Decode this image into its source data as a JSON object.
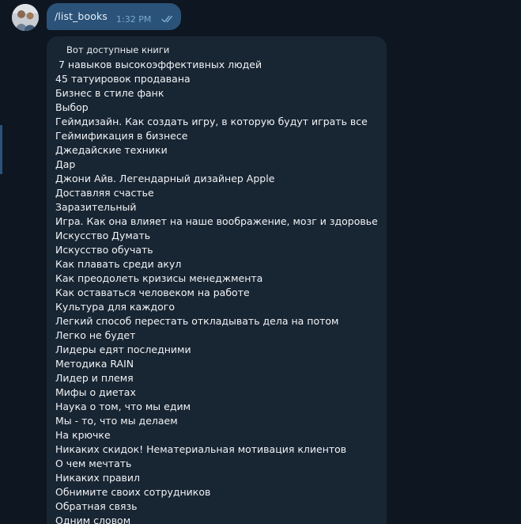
{
  "outgoing": {
    "text": "/list_books",
    "time": "1:32 PM"
  },
  "incoming": {
    "header": "Вот доступные книги",
    "books": [
      " 7 навыков высокоэффективных людей",
      "45 татуировок продавана",
      "Бизнес в стиле фанк",
      "Выбор",
      "Геймдизайн. Как создать игру, в которую будут играть все",
      "Геймификация в бизнесе",
      "Джедайские техники",
      "Дар",
      "Джони Айв. Легендарный дизайнер Apple",
      "Доставляя счастье",
      "Заразительный",
      "Игра. Как она влияет на наше воображение, мозг и здоровье",
      "Искусство Думать",
      "Искусство обучать",
      "Как плавать среди акул",
      "Как преодолеть кризисы менеджмента",
      "Как оставаться человеком на работе",
      "Культура для каждого",
      "Легкий способ перестать откладывать дела на потом",
      "Легко не будет",
      "Лидеры едят последними",
      "Методика RAIN",
      "Лидер и племя",
      "Мифы о диетах",
      "Наука о том, что мы едим",
      "Мы - то, что мы делаем",
      "На крючке",
      "Никаких скидок! Нематериальная мотивация клиентов",
      "О чем мечтать",
      "Никаких правил",
      "Обнимите своих сотрудников",
      "Обратная связь",
      "Одним словом"
    ]
  },
  "colors": {
    "background": "#0e1621",
    "outgoing_bubble": "#2b5278",
    "incoming_bubble": "#182533",
    "read_ticks": "#7da8d3"
  },
  "icons": {
    "avatar": "user-avatar",
    "read_status": "double-check-icon"
  }
}
